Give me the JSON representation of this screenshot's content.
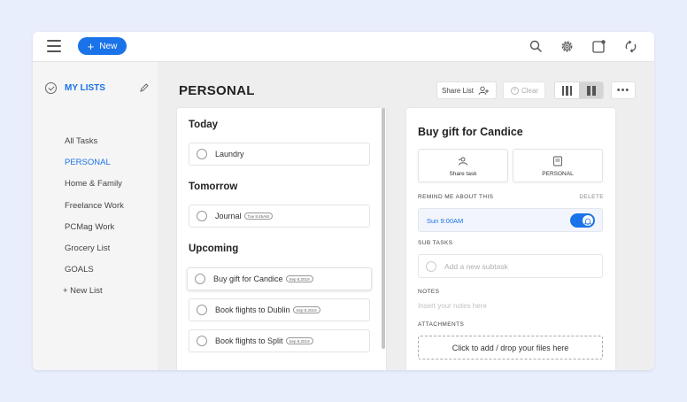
{
  "topbar": {
    "new_label": "New",
    "new_plus": "+"
  },
  "sidebar": {
    "header_title": "MY LISTS",
    "items": [
      {
        "label": "All Tasks"
      },
      {
        "label": "PERSONAL",
        "active": true
      },
      {
        "label": "Home & Family"
      },
      {
        "label": "Freelance Work"
      },
      {
        "label": "PCMag Work"
      },
      {
        "label": "Grocery List"
      },
      {
        "label": "GOALS"
      },
      {
        "label": "+ New List"
      }
    ]
  },
  "main": {
    "title": "PERSONAL",
    "share_list_label": "Share List",
    "clear_label": "Clear",
    "more_label": "•••",
    "sections": [
      {
        "title": "Today",
        "tasks": [
          {
            "label": "Laundry",
            "due": ""
          }
        ]
      },
      {
        "title": "Tomorrow",
        "tasks": [
          {
            "label": "Journal",
            "due": "Tue 9:45AM"
          }
        ]
      },
      {
        "title": "Upcoming",
        "tasks": [
          {
            "label": "Buy gift for Candice",
            "due": "Sep 8,2019",
            "selected": true
          },
          {
            "label": "Book flights to Dublin",
            "due": "Sep 8,2019"
          },
          {
            "label": "Book flights to Split",
            "due": "Sep 8,2019"
          }
        ]
      }
    ]
  },
  "detail": {
    "title": "Buy gift for Candice",
    "share_task_label": "Share task",
    "list_label": "PERSONAL",
    "remind_label": "REMIND ME ABOUT THIS",
    "delete_label": "DELETE",
    "reminder_time": "Sun 9:00AM",
    "reminder_on": true,
    "subtasks_label": "SUB TASKS",
    "subtask_placeholder": "Add a new subtask",
    "notes_label": "NOTES",
    "notes_placeholder": "Insert your notes here",
    "attachments_label": "ATTACHMENTS",
    "dropzone_label": "Click to add / drop your files here"
  },
  "colors": {
    "accent": "#1a73e8",
    "background": "#e9eefc"
  }
}
